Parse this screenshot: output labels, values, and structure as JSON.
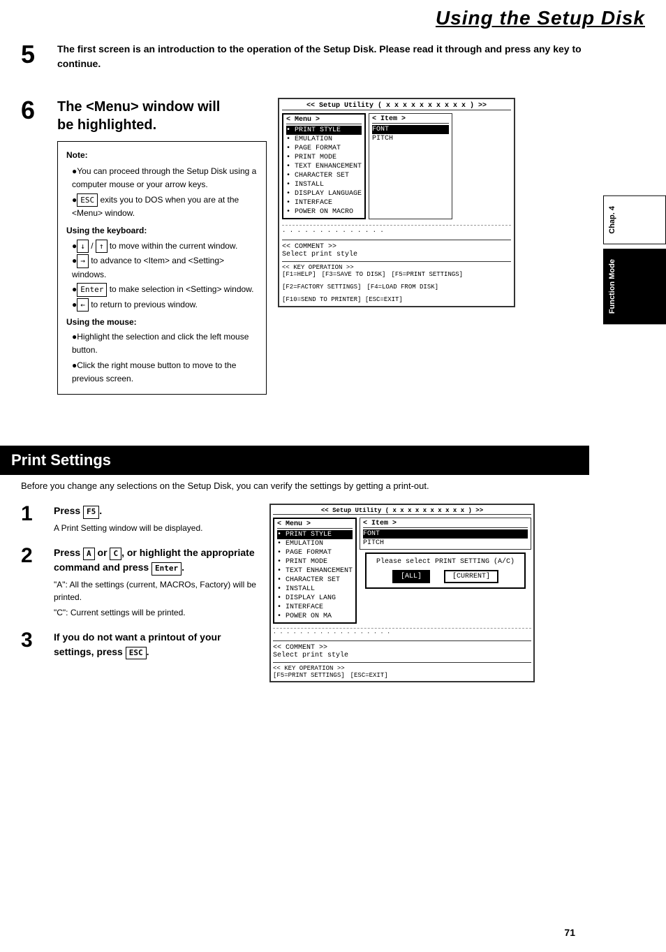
{
  "header": {
    "title": "Using the Setup Disk"
  },
  "step5": {
    "number": "5",
    "text": "The first screen is an introduction to the operation of the Setup Disk. Please read it through and press any key to continue."
  },
  "step6": {
    "number": "6",
    "title_line1": "The <Menu> window will",
    "title_line2": "be highlighted.",
    "note": {
      "title": "Note:",
      "items": [
        "You can proceed through the Setup Disk using a computer mouse or your arrow keys.",
        "[ESC] exits you to DOS when you are at the <Menu> window."
      ],
      "keyboard_title": "Using the keyboard:",
      "keyboard_items": [
        "↓ / ↑ to move within the current window.",
        "→ to advance to <Item> and <Setting> windows.",
        "[Enter] to make selection in <Setting> window.",
        "← to return to previous window."
      ],
      "mouse_title": "Using the mouse:",
      "mouse_items": [
        "Highlight the selection and click the left mouse button.",
        "Click the right mouse button to move to the previous screen."
      ]
    }
  },
  "setup_screen_1": {
    "title": "<< Setup Utility ( x x x x x x x x x x ) >>",
    "left_pane_title": "< Menu >",
    "left_pane_items": [
      "• PRINT STYLE",
      "• EMULATION",
      "• PAGE FORMAT",
      "• PRINT MODE",
      "• TEXT ENHANCEMENT",
      "• CHARACTER SET",
      "• INSTALL",
      "• DISPLAY LANGUAGE",
      "• INTERFACE",
      "• POWER ON MACRO"
    ],
    "right_pane_title": "< Item >",
    "right_pane_items": [
      "FONT",
      "PITCH"
    ],
    "comment_title": "<< COMMENT >>",
    "comment_text": "Select print style",
    "keyop_title": "<< KEY OPERATION >>",
    "keyop_items": [
      "[F1=HELP]",
      "[F3=SAVE TO DISK]",
      "[F5=PRINT SETTINGS]",
      "[F2=FACTORY SETTINGS]",
      "[F4=LOAD FROM DISK]",
      "[F10=SEND TO PRINTER] [ESC=EXIT]"
    ]
  },
  "print_settings": {
    "section_title": "Print Settings",
    "intro": "Before you change any selections on the Setup Disk, you can verify the settings by getting a print-out.",
    "step1": {
      "number": "1",
      "title": "Press [F5].",
      "desc": "A Print Setting window will be displayed."
    },
    "step2": {
      "number": "2",
      "title": "Press [A] or [C], or highlight the appropriate command and press [Enter].",
      "desc_a": "\"A\":  All the settings (current, MACROs, Factory) will be printed.",
      "desc_c": "\"C\":  Current settings will be printed."
    },
    "step3": {
      "number": "3",
      "title": "If you do not want a print-out of your settings, press [ESC]."
    }
  },
  "setup_screen_2": {
    "title": "<< Setup Utility ( x x x x x x x x x x ) >>",
    "left_pane_title": "< Menu >",
    "left_pane_items": [
      "• PRINT STYLE",
      "• EMULATION",
      "• PAGE FORMAT",
      "• PRINT MODE",
      "• TEXT ENHANCEMENT",
      "• CHARACTER SET",
      "• INSTALL",
      "• DISPLAY LANG",
      "• INTERFACE",
      "• POWER ON MA"
    ],
    "right_pane_title": "< Item >",
    "right_pane_items": [
      "FONT",
      "PITCH"
    ],
    "dialog_text": "Please select PRINT SETTING  (A/C)",
    "dialog_btn1": "[ALL]",
    "dialog_btn2": "[CURRENT]",
    "comment_title": "<< COMMENT >>",
    "comment_text": "Select print style",
    "keyop_title": "<< KEY OPERATION >>",
    "keyop_items": [
      "[F5=PRINT SETTINGS]",
      "[ESC=EXIT]"
    ]
  },
  "side_tab": {
    "chap": "Chap. 4",
    "func": "Function Mode"
  },
  "page_number": "71"
}
